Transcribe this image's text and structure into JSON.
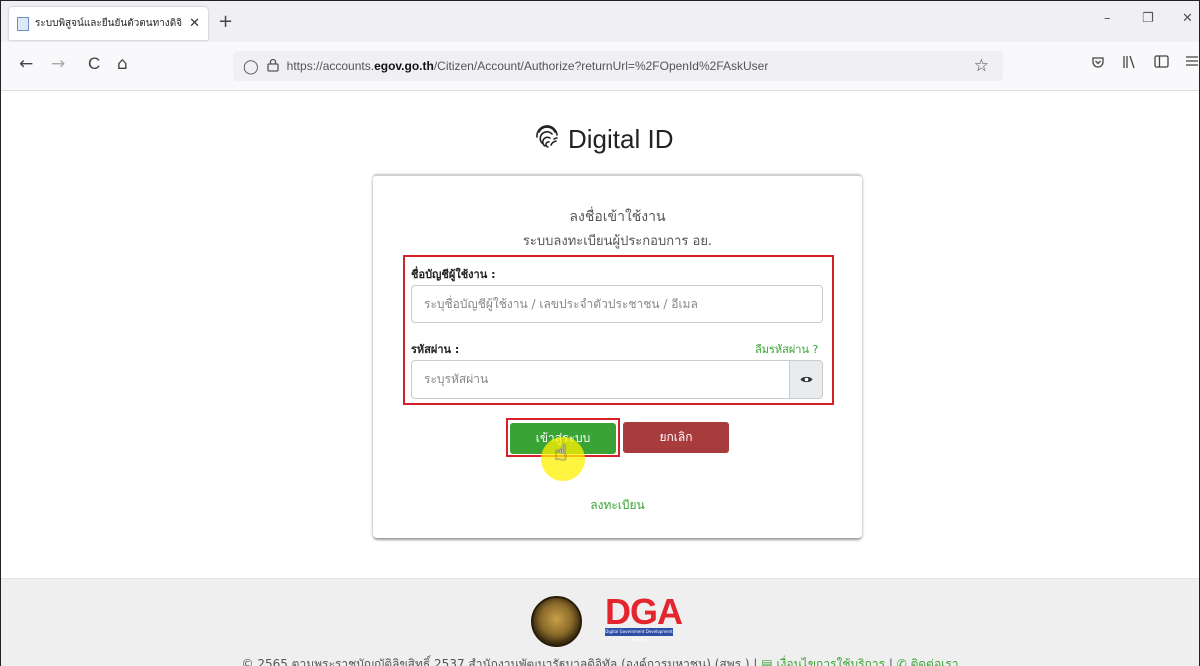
{
  "browser": {
    "tab_title": "ระบบพิสูจน์และยืนยันตัวตนทางดิจิ",
    "tab_close": "✕",
    "new_tab": "+",
    "url_prefix": "https://accounts.",
    "url_domain": "egov.go.th",
    "url_path": "/Citizen/Account/Authorize?returnUrl=%2FOpenId%2FAskUser",
    "back": "←",
    "forward": "→",
    "reload": "C",
    "home": "⌂",
    "bookmark_star": "☆",
    "minimize": "–",
    "restore": "❐",
    "close": "✕"
  },
  "page": {
    "brand": "Digital ID",
    "heading": "ลงชื่อเข้าใช้งาน",
    "subheading": "ระบบลงทะเบียนผู้ประกอบการ อย.",
    "username_label": "ชื่อบัญชีผู้ใช้งาน :",
    "username_placeholder": "ระบุชื่อบัญชีผู้ใช้งาน / เลขประจำตัวประชาชน / อีเมล",
    "password_label": "รหัสผ่าน :",
    "forgot_password": "ลืมรหัสผ่าน ?",
    "password_placeholder": "ระบุรหัสผ่าน",
    "login_button": "เข้าสู่ระบบ",
    "cancel_button": "ยกเลิก",
    "register_link": "ลงทะเบียน"
  },
  "footer": {
    "logo_text": "DGA",
    "logo_subtitle": "Digital Government Development Agency",
    "copyright": "© 2565 ตามพระราชบัญญัติลิขสิทธิ์ 2537 สำนักงานพัฒนารัฐบาลดิจิทัล (องค์การมหาชน) (สพร.) | ",
    "terms_link": "เงื่อนไขการใช้บริการ",
    "separator": " | ",
    "contact_link": "ติดต่อเรา"
  },
  "colors": {
    "accent_green": "#3aa335",
    "cancel_red": "#a83c3c",
    "highlight_red": "#d6202a",
    "dga_red": "#e3262e"
  }
}
